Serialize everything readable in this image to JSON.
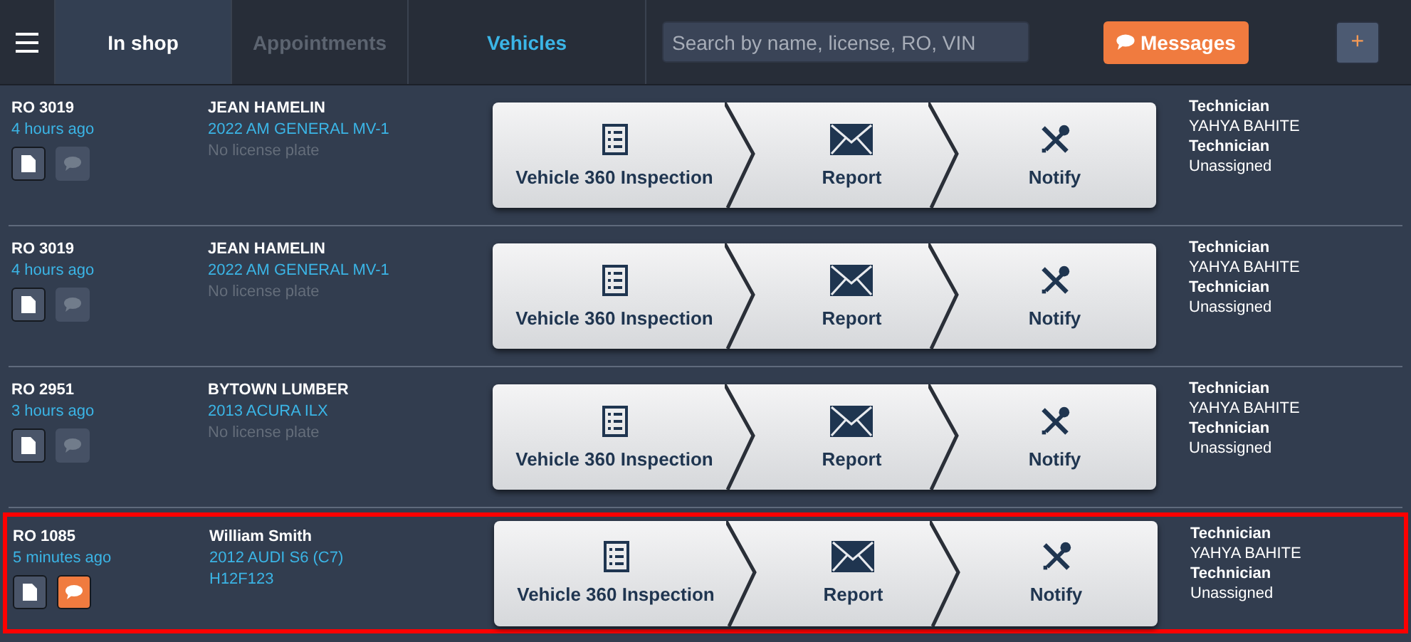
{
  "header": {
    "tabs": [
      {
        "label": "In shop",
        "selected": true,
        "disabled": false
      },
      {
        "label": "Appointments",
        "selected": false,
        "disabled": true
      },
      {
        "label": "Vehicles",
        "selected": false,
        "disabled": false
      }
    ],
    "search": {
      "placeholder": "Search by name, license, RO, VIN"
    },
    "messages_button": "Messages",
    "add_button": "+"
  },
  "orders": [
    {
      "ro": "RO 3019",
      "time": "4 hours ago",
      "customer": "JEAN HAMELIN",
      "vehicle": "2022 AM GENERAL MV-1",
      "plate": "No license plate",
      "plate_known": false,
      "has_messages": false,
      "selected": false,
      "steps": [
        "Vehicle 360 Inspection",
        "Report",
        "Notify"
      ],
      "staff": [
        {
          "role": "Technician",
          "name": "YAHYA BAHITE"
        },
        {
          "role": "Technician",
          "name": "Unassigned"
        }
      ]
    },
    {
      "ro": "RO 3019",
      "time": "4 hours ago",
      "customer": "JEAN HAMELIN",
      "vehicle": "2022 AM GENERAL MV-1",
      "plate": "No license plate",
      "plate_known": false,
      "has_messages": false,
      "selected": false,
      "steps": [
        "Vehicle 360 Inspection",
        "Report",
        "Notify"
      ],
      "staff": [
        {
          "role": "Technician",
          "name": "YAHYA BAHITE"
        },
        {
          "role": "Technician",
          "name": "Unassigned"
        }
      ]
    },
    {
      "ro": "RO 2951",
      "time": "3 hours ago",
      "customer": "BYTOWN LUMBER",
      "vehicle": "2013 ACURA ILX",
      "plate": "No license plate",
      "plate_known": false,
      "has_messages": false,
      "selected": false,
      "steps": [
        "Vehicle 360 Inspection",
        "Report",
        "Notify"
      ],
      "staff": [
        {
          "role": "Technician",
          "name": "YAHYA BAHITE"
        },
        {
          "role": "Technician",
          "name": "Unassigned"
        }
      ]
    },
    {
      "ro": "RO 1085",
      "time": "5 minutes ago",
      "customer": "William Smith",
      "vehicle": "2012 AUDI S6 (C7)",
      "plate": "H12F123",
      "plate_known": true,
      "has_messages": true,
      "selected": true,
      "steps": [
        "Vehicle 360 Inspection",
        "Report",
        "Notify"
      ],
      "staff": [
        {
          "role": "Technician",
          "name": "YAHYA BAHITE"
        },
        {
          "role": "Technician",
          "name": "Unassigned"
        }
      ]
    }
  ]
}
